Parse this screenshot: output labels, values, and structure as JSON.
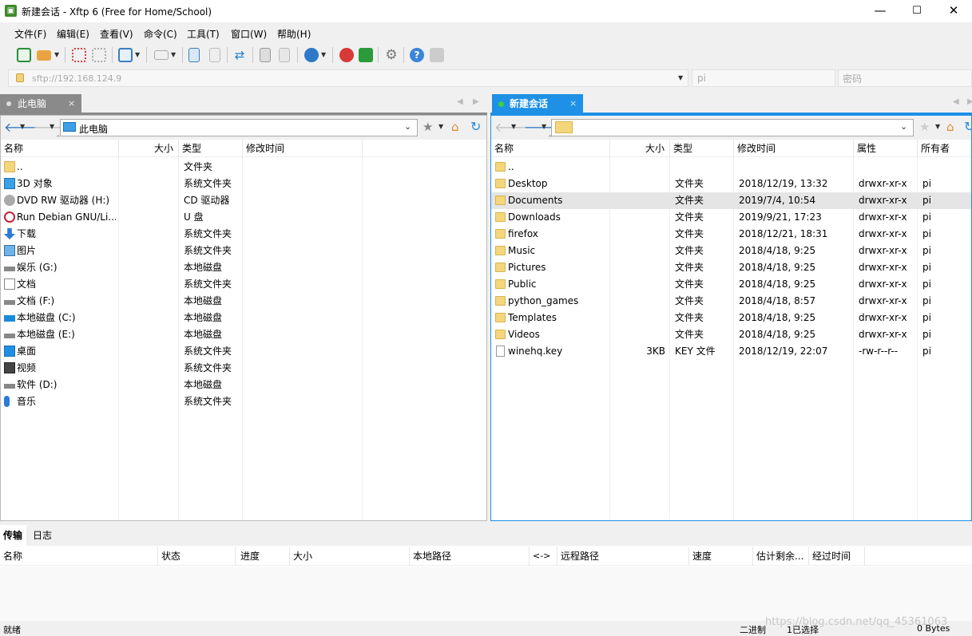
{
  "window": {
    "title": "新建会话 - Xftp 6 (Free for Home/School)",
    "icon": "xftp-icon",
    "minimize": "—",
    "maximize": "☐",
    "close": "✕"
  },
  "menu": [
    "文件(F)",
    "编辑(E)",
    "查看(V)",
    "命令(C)",
    "工具(T)",
    "窗口(W)",
    "帮助(H)"
  ],
  "address": {
    "value": "sftp://192.168.124.9",
    "user": "pi",
    "password_placeholder": "密码"
  },
  "left": {
    "tab": "此电脑",
    "tab_close": "×",
    "path": "此电脑",
    "columns": [
      "名称",
      "大小",
      "类型",
      "修改时间"
    ],
    "rows": [
      {
        "name": "..",
        "size": "",
        "type": "文件夹",
        "icon": "folder-icon"
      },
      {
        "name": "3D 对象",
        "size": "",
        "type": "系统文件夹",
        "icon": "3d-objects-icon"
      },
      {
        "name": "DVD RW 驱动器 (H:)",
        "size": "",
        "type": "CD 驱动器",
        "icon": "dvd-icon"
      },
      {
        "name": "Run Debian GNU/Li...",
        "size": "",
        "type": "U 盘",
        "icon": "debian-icon"
      },
      {
        "name": "下载",
        "size": "",
        "type": "系统文件夹",
        "icon": "download-icon"
      },
      {
        "name": "图片",
        "size": "",
        "type": "系统文件夹",
        "icon": "pictures-icon"
      },
      {
        "name": "娱乐 (G:)",
        "size": "",
        "type": "本地磁盘",
        "icon": "drive-icon"
      },
      {
        "name": "文档",
        "size": "",
        "type": "系统文件夹",
        "icon": "documents-icon"
      },
      {
        "name": "文档 (F:)",
        "size": "",
        "type": "本地磁盘",
        "icon": "drive-icon"
      },
      {
        "name": "本地磁盘 (C:)",
        "size": "",
        "type": "本地磁盘",
        "icon": "windows-drive-icon"
      },
      {
        "name": "本地磁盘 (E:)",
        "size": "",
        "type": "本地磁盘",
        "icon": "drive-icon"
      },
      {
        "name": "桌面",
        "size": "",
        "type": "系统文件夹",
        "icon": "desktop-icon"
      },
      {
        "name": "视频",
        "size": "",
        "type": "系统文件夹",
        "icon": "videos-icon"
      },
      {
        "name": "软件 (D:)",
        "size": "",
        "type": "本地磁盘",
        "icon": "drive-icon"
      },
      {
        "name": "音乐",
        "size": "",
        "type": "系统文件夹",
        "icon": "music-icon"
      }
    ]
  },
  "right": {
    "tab": "新建会话",
    "tab_close": "×",
    "columns": [
      "名称",
      "大小",
      "类型",
      "修改时间",
      "属性",
      "所有者"
    ],
    "rows": [
      {
        "name": "..",
        "size": "",
        "type": "",
        "mtime": "",
        "perm": "",
        "owner": ""
      },
      {
        "name": "Desktop",
        "size": "",
        "type": "文件夹",
        "mtime": "2018/12/19, 13:32",
        "perm": "drwxr-xr-x",
        "owner": "pi"
      },
      {
        "name": "Documents",
        "size": "",
        "type": "文件夹",
        "mtime": "2019/7/4, 10:54",
        "perm": "drwxr-xr-x",
        "owner": "pi"
      },
      {
        "name": "Downloads",
        "size": "",
        "type": "文件夹",
        "mtime": "2019/9/21, 17:23",
        "perm": "drwxr-xr-x",
        "owner": "pi"
      },
      {
        "name": "firefox",
        "size": "",
        "type": "文件夹",
        "mtime": "2018/12/21, 18:31",
        "perm": "drwxr-xr-x",
        "owner": "pi"
      },
      {
        "name": "Music",
        "size": "",
        "type": "文件夹",
        "mtime": "2018/4/18, 9:25",
        "perm": "drwxr-xr-x",
        "owner": "pi"
      },
      {
        "name": "Pictures",
        "size": "",
        "type": "文件夹",
        "mtime": "2018/4/18, 9:25",
        "perm": "drwxr-xr-x",
        "owner": "pi"
      },
      {
        "name": "Public",
        "size": "",
        "type": "文件夹",
        "mtime": "2018/4/18, 9:25",
        "perm": "drwxr-xr-x",
        "owner": "pi"
      },
      {
        "name": "python_games",
        "size": "",
        "type": "文件夹",
        "mtime": "2018/4/18, 8:57",
        "perm": "drwxr-xr-x",
        "owner": "pi"
      },
      {
        "name": "Templates",
        "size": "",
        "type": "文件夹",
        "mtime": "2018/4/18, 9:25",
        "perm": "drwxr-xr-x",
        "owner": "pi"
      },
      {
        "name": "Videos",
        "size": "",
        "type": "文件夹",
        "mtime": "2018/4/18, 9:25",
        "perm": "drwxr-xr-x",
        "owner": "pi"
      },
      {
        "name": "winehq.key",
        "size": "3KB",
        "type": "KEY 文件",
        "mtime": "2018/12/19, 22:07",
        "perm": "-rw-r--r--",
        "owner": "pi"
      }
    ]
  },
  "bottom": {
    "tabs": [
      "传输",
      "日志"
    ],
    "columns": [
      "名称",
      "状态",
      "进度",
      "大小",
      "本地路径",
      "<->",
      "远程路径",
      "速度",
      "估计剩余...",
      "经过时间"
    ]
  },
  "status": {
    "left": "就绪",
    "mode": "二进制",
    "selected": "1已选择",
    "bytes": "0 Bytes",
    "watermark": "https://blog.csdn.net/qq_45361063"
  },
  "colors": {
    "accent": "#1e90e6",
    "tab_inactive": "#8a8a8a",
    "selection": "#e5e5e5",
    "folder": "#f4d67c",
    "green_dot": "#3dd13d"
  }
}
